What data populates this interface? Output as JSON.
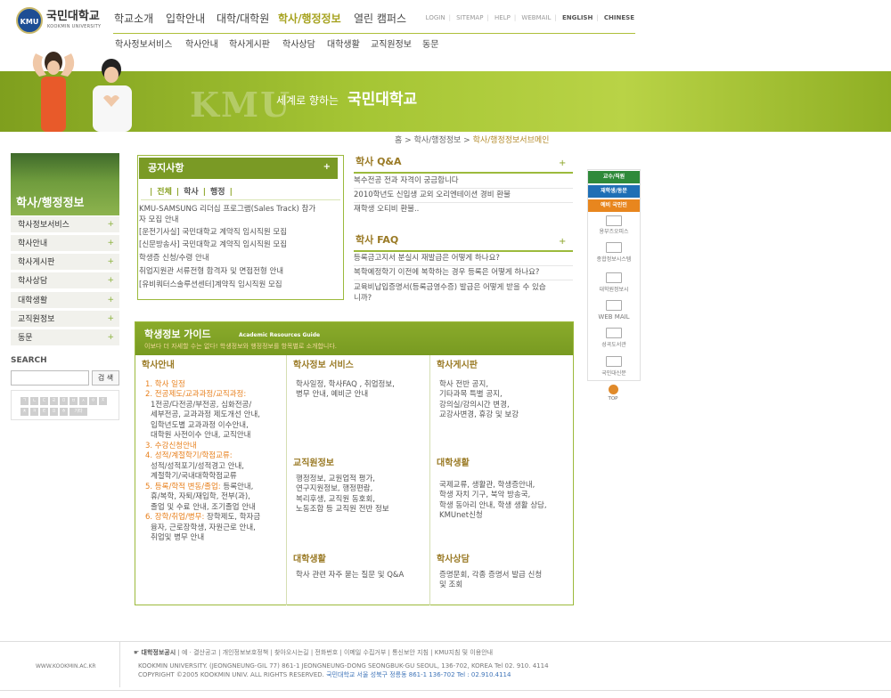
{
  "header": {
    "logo_badge": "KMU",
    "logo_name": "국민대학교",
    "logo_sub": "KOOKMIN UNIVERSITY",
    "gnb": [
      "학교소개",
      "입학안내",
      "대학/대학원",
      "학사/행정정보",
      "열린 캠퍼스"
    ],
    "util": [
      "LOGIN",
      "SITEMAP",
      "HELP",
      "WEBMAIL",
      "ENGLISH",
      "CHINESE"
    ],
    "lnb": [
      "학사정보서비스",
      "학사안내",
      "학사게시판",
      "학사상담",
      "대학생활",
      "교직원정보",
      "동문"
    ]
  },
  "banner": {
    "kmu": "KMU",
    "slogan": "세계로 향하는",
    "name": "국민대학교"
  },
  "breadcrumb": {
    "home": "홈",
    "sep": ">",
    "level1": "학사/행정정보",
    "current": "학사/행정정보서브메인"
  },
  "sidebar": {
    "title": "학사/행정정보",
    "items": [
      "학사정보서비스",
      "학사안내",
      "학사게시판",
      "학사상담",
      "대학생활",
      "교직원정보",
      "동문"
    ],
    "plus": "+",
    "search_label": "SEARCH",
    "search_button": "검 색",
    "index_row1": [
      "ㄱ",
      "ㄴ",
      "ㄷ",
      "ㄹ",
      "ㅁ",
      "ㅂ",
      "ㅅ",
      "ㅇ",
      "ㅈ"
    ],
    "index_row2": [
      "ㅊ",
      "ㅋ",
      "ㅌ",
      "ㅍ",
      "ㅎ",
      "기타"
    ]
  },
  "notice": {
    "title": "공지사항",
    "plus": "+",
    "tabs": [
      "전체",
      "학사",
      "행정"
    ],
    "items": [
      "KMU-SAMSUNG 리더십 프로그램(Sales Track) 참가",
      "자 모집 안내",
      "[운전기사실] 국민대학교 계약직 임시직원 모집",
      "[신문방송사] 국민대학교 계약직 임시직원 모집",
      "학생증 신청/수령 안내",
      "취업지원관 서류전형 합격자 및 면접전형 안내",
      "[유비쿼터스솔루션센터]계약직 임시직원 모집"
    ]
  },
  "qna": {
    "title": "학사 Q&A",
    "plus": "+",
    "items": [
      "복수전공 전과 자격이 궁금합니다",
      "2010학년도 신입생 교외 오리엔테이션 경비 환불",
      "재학생 오티비 환불.."
    ]
  },
  "faq": {
    "title": "학사 FAQ",
    "plus": "+",
    "items": [
      "등록금고지서 분실시 재발급은 어떻게 하나요?",
      "복학예정학기 이전에 복학하는 경우 등록은 어떻게 하나요?",
      "교육비납입증명서(등록금영수증) 발급은 어떻게 받을 수 있습",
      "니까?"
    ]
  },
  "quick_menu": {
    "buttons": [
      {
        "label": "교수/직원",
        "color": "#2f8a3a"
      },
      {
        "label": "재학생/동문",
        "color": "#1f6fb5"
      },
      {
        "label": "예비 국민인",
        "color": "#e8861e"
      }
    ],
    "links": [
      "용부즈오피스",
      "종합정보시스템",
      "대학원정보시",
      "WEB MAIL",
      "성곡도서관",
      "국민대신문"
    ],
    "top": "TOP"
  },
  "guide": {
    "title": "학생정보 가이드",
    "title_en": "Academic Resources Guide",
    "subtitle": "이보다 더 자세할 수는 없다! 학생정보와 행정정보를 항목별로 소개합니다.",
    "col1": {
      "heading": "학사안내",
      "lines": [
        {
          "text": "1. 학사 일정",
          "accent": true
        },
        {
          "text": "2. 전공제도/교과과정/교직과정:",
          "accent": true
        },
        {
          "text": "1전공/다전공/부전공, 심화전공/",
          "accent": false
        },
        {
          "text": "세부전공, 교과과정 제도개선 안내,",
          "accent": false
        },
        {
          "text": "입학년도별 교과과정 이수안내,",
          "accent": false
        },
        {
          "text": "대학원 사전이수 안내, 교직안내",
          "accent": false
        },
        {
          "text": "3. 수강신청안내",
          "accent": true
        },
        {
          "text": "4. 성적/계절학기/학점교류:",
          "accent": true
        },
        {
          "text": "성적/성적포기/성적경고 안내,",
          "accent": false
        },
        {
          "text": "계절학기/국내대학학점교류",
          "accent": false
        },
        {
          "text": "5. 등록/학적 변동/졸업: 등록안내,",
          "accent": "partial",
          "accent_part": "5. 등록/학적 변동/졸업:",
          "rest": " 등록안내,"
        },
        {
          "text": "휴/복학, 자퇴/재입학, 전부(과),",
          "accent": false
        },
        {
          "text": "졸업 및 수료 안내, 조기졸업 안내",
          "accent": false
        },
        {
          "text": "6. 장학/취업/병무: 장학제도, 학자금",
          "accent": "partial",
          "accent_part": "6. 장학/취업/병무:",
          "rest": " 장학제도, 학자금"
        },
        {
          "text": "융자, 근로장학생, 자원근로 안내,",
          "accent": false
        },
        {
          "text": "취업및 병무 안내",
          "accent": false
        }
      ]
    },
    "col2": {
      "sections": [
        {
          "heading": "학사정보 서비스",
          "lines": [
            "학사일정, 학사FAQ , 취업정보,",
            "병무 안내, 예비군 안내"
          ]
        },
        {
          "heading": "교직원정보",
          "lines": [
            "행정정보, 교원업적 평가,",
            "연구지원정보, 행정편람,",
            "복리후생, 교직원 동호회,",
            "노동조합 등 교직원 전반 정보"
          ]
        },
        {
          "heading": "대학생활",
          "lines": [
            "학사 관련 자주 묻는 질문 및 Q&A"
          ]
        }
      ]
    },
    "col3": {
      "sections": [
        {
          "heading": "학사게시판",
          "lines": [
            "학사 전반 공지,",
            "기타과목 특별 공지,",
            "강의실/강의시간 변경,",
            "교강사변경, 휴강 및 보강"
          ]
        },
        {
          "heading": "대학생활",
          "lines": [
            "국제교류, 생활관, 학생증안내,",
            "학생 자치 기구, 북악 방송국,",
            "학생 동아리 안내, 학생 생활 상담,",
            "KMUnet신청"
          ]
        },
        {
          "heading": "학사상담",
          "lines": [
            "증명문회, 각종 증명서 발급 신청",
            "및 조회"
          ]
        }
      ]
    }
  },
  "footer": {
    "url": "WWW.KOOKMIN.AC.KR",
    "links_bold": "대학정보공시",
    "links": "| 예 · 결산공고 | 개인정보보호정책 | 찾아오시는길 | 전화번호 | 이메일 수집거부 | 통신보안 지침 | KMU지침 및 이용안내",
    "addr1": "KOOKMIN UNIVERSITY. (JEONGNEUNG-GIL 77) 861-1 JEONGNEUNG-DONG SEONGBUK-GU SEOUL, 136-702, KOREA Tel 02. 910. 4114",
    "addr2": "COPYRIGHT ©2005 KOOKMIN UNIV. ALL RIGHTS RESERVED.",
    "addr2_kr": "국민대학교 서울 성북구 정릉동 861-1 136-702 Tel : 02.910.4114"
  }
}
